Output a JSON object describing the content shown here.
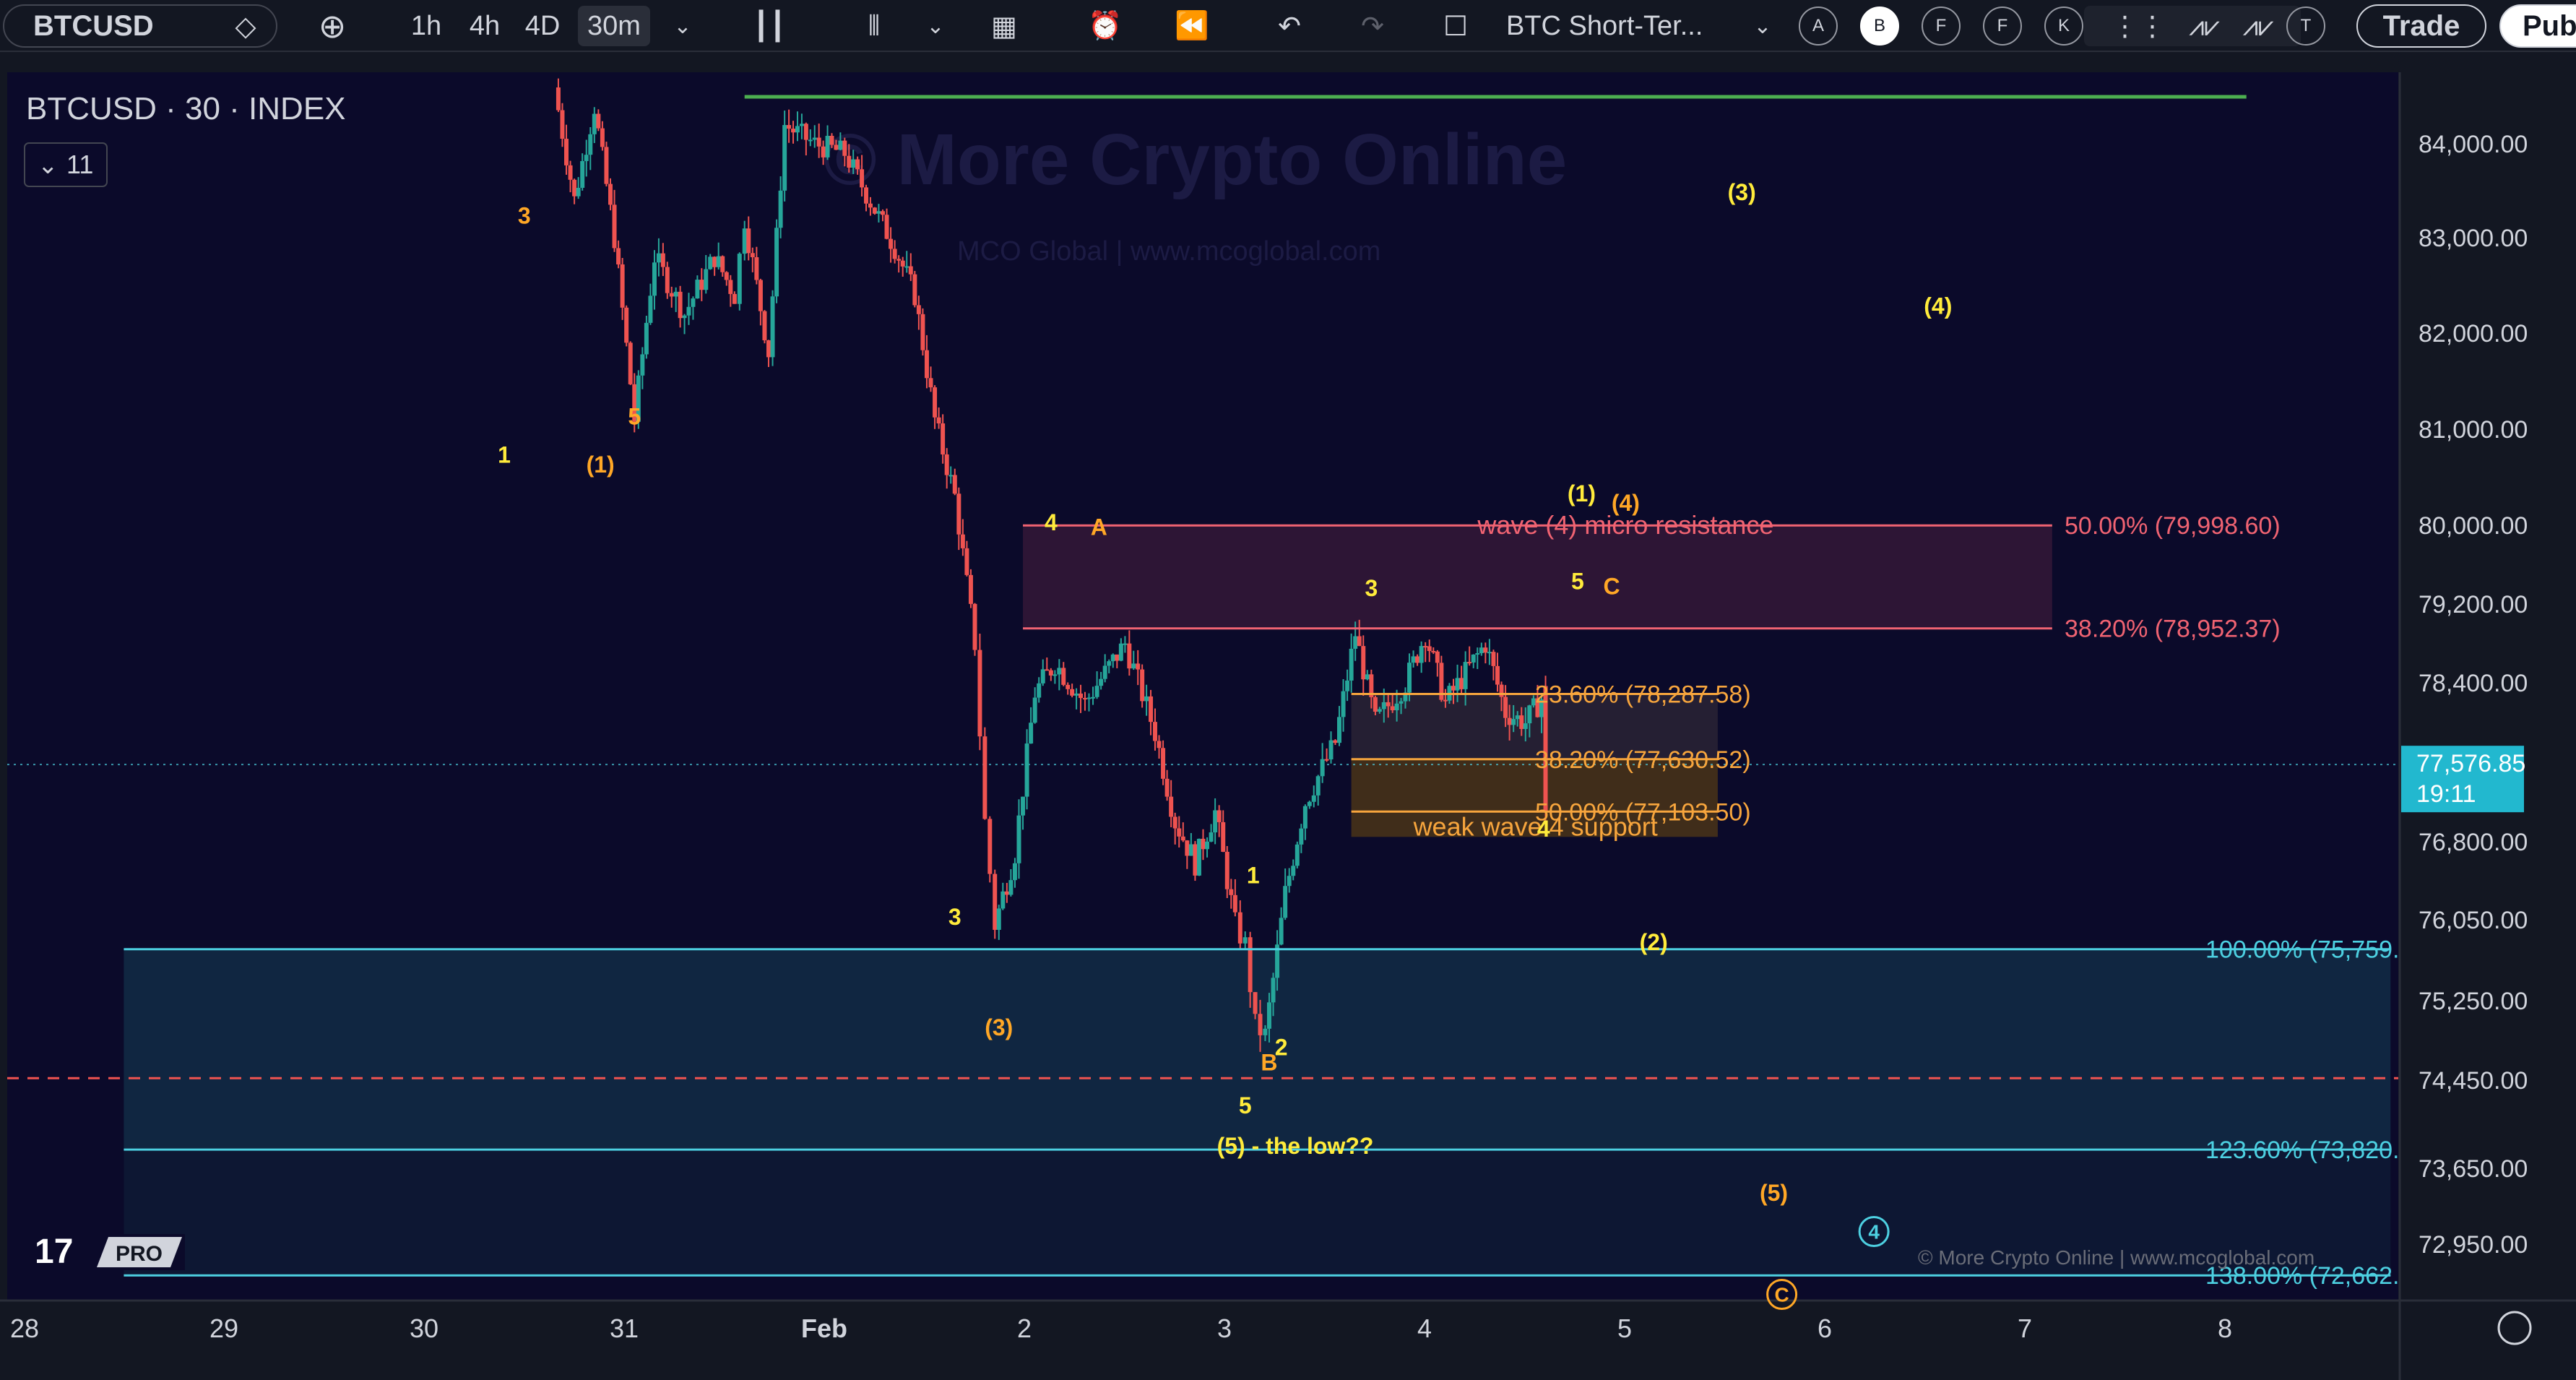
{
  "toolbar": {
    "symbol": "BTCUSD",
    "intervals": [
      "1h",
      "4h",
      "4D",
      "30m"
    ],
    "active_interval": "30m",
    "layout_name": "BTC Short-Ter...",
    "alert_buttons": [
      "A",
      "B",
      "F",
      "F",
      "K",
      "T"
    ],
    "trade_label": "Trade",
    "publish_label": "Pub",
    "icons": [
      "gem-icon",
      "plus-icon",
      "chevron-down-icon",
      "candles-icon",
      "indicators-icon",
      "chevron-down-icon",
      "templates-icon",
      "alert-icon",
      "replay-icon",
      "undo-icon",
      "redo-icon",
      "layout-square-icon",
      "chevron-down-icon"
    ]
  },
  "chart_header": {
    "title": "BTCUSD · 30 · INDEX",
    "indicators_count": "11"
  },
  "watermark": {
    "main": "© More Crypto Online",
    "sub": "MCO Global  |  www.mcoglobal.com",
    "footer": "© More Crypto Online  |  www.mcoglobal.com",
    "logo": "TV PRO"
  },
  "colors": {
    "background": "#0b0a2a",
    "up_candle": "#26a69a",
    "down_candle": "#ef5350",
    "resistance": "#f06372",
    "support": "#f7a53d",
    "cyan": "#4dd0e1",
    "green_line": "#4caf50",
    "wave_yellow": "#ffeb3b",
    "wave_orange": "#ffa726"
  },
  "chart_data": {
    "type": "candlestick",
    "title": "BTCUSD · 30 · INDEX",
    "y_ticks": [
      "84,000.00",
      "83,000.00",
      "82,000.00",
      "81,000.00",
      "80,000.00",
      "79,200.00",
      "78,400.00",
      "76,800.00",
      "76,050.00",
      "75,250.00",
      "74,450.00",
      "73,650.00",
      "72,950.00"
    ],
    "y_tick_values": [
      84000,
      83000,
      82000,
      81000,
      80000,
      79200,
      78400,
      76800,
      76050,
      75250,
      74450,
      73650,
      72950
    ],
    "x_ticks": [
      "28",
      "29",
      "30",
      "31",
      "Feb",
      "2",
      "3",
      "4",
      "5",
      "6",
      "7",
      "8"
    ],
    "x_tick_values": [
      28,
      29,
      30,
      31,
      32,
      33,
      34,
      35,
      36,
      37,
      38,
      39
    ],
    "last_price": "77,576.85",
    "last_price_value": 77576.85,
    "countdown": "19:11",
    "dashed_level": 74470,
    "price_path": [
      [
        29.65,
        84600
      ],
      [
        29.75,
        83400
      ],
      [
        29.85,
        84400
      ],
      [
        29.95,
        83000
      ],
      [
        30.05,
        81100
      ],
      [
        30.15,
        82800
      ],
      [
        30.3,
        82200
      ],
      [
        30.45,
        82800
      ],
      [
        30.55,
        82400
      ],
      [
        30.6,
        83200
      ],
      [
        30.72,
        81800
      ],
      [
        30.8,
        84200
      ],
      [
        30.95,
        84000
      ],
      [
        31.1,
        83900
      ],
      [
        31.25,
        83300
      ],
      [
        31.35,
        82900
      ],
      [
        31.45,
        82400
      ],
      [
        31.55,
        81100
      ],
      [
        31.65,
        80300
      ],
      [
        31.75,
        78800
      ],
      [
        31.8,
        77000
      ],
      [
        31.85,
        76000
      ],
      [
        31.95,
        76700
      ],
      [
        32.05,
        78300
      ],
      [
        32.15,
        78600
      ],
      [
        32.3,
        78200
      ],
      [
        32.5,
        78800
      ],
      [
        32.65,
        77900
      ],
      [
        32.75,
        77000
      ],
      [
        32.85,
        76600
      ],
      [
        32.95,
        77100
      ],
      [
        33.05,
        76000
      ],
      [
        33.1,
        75800
      ],
      [
        33.15,
        75000
      ],
      [
        33.2,
        74900
      ],
      [
        33.3,
        76300
      ],
      [
        33.4,
        77200
      ],
      [
        33.55,
        77800
      ],
      [
        33.65,
        78900
      ],
      [
        33.75,
        78000
      ],
      [
        33.9,
        78400
      ],
      [
        34.0,
        78900
      ],
      [
        34.1,
        78200
      ],
      [
        34.2,
        78500
      ],
      [
        34.3,
        78800
      ],
      [
        34.4,
        78100
      ],
      [
        34.5,
        78000
      ],
      [
        34.6,
        78300
      ],
      [
        34.6,
        77150
      ]
    ],
    "levels": [
      {
        "label": "50.00% (79,998.60)",
        "value": 79998.6,
        "color": "#f06372",
        "x_start": 31.99,
        "x_end": 37.13
      },
      {
        "label": "38.20% (78,952.37)",
        "value": 78952.37,
        "color": "#f06372",
        "x_start": 31.99,
        "x_end": 37.13
      },
      {
        "label": "23.60% (78,287.58)",
        "value": 78287.58,
        "color": "#f7a53d",
        "x_start": 33.63,
        "x_end": 35.46
      },
      {
        "label": "38.20% (77,630.52)",
        "value": 77630.52,
        "color": "#f7a53d",
        "x_start": 33.63,
        "x_end": 35.46
      },
      {
        "label": "50.00% (77,103.50)",
        "value": 77103.5,
        "color": "#f7a53d",
        "x_start": 33.63,
        "x_end": 35.46
      },
      {
        "label": "100.00% (75,759.",
        "value": 75759,
        "color": "#4dd0e1",
        "x_start": 27.5,
        "x_end": 38.82
      },
      {
        "label": "123.60% (73,820.",
        "value": 73820,
        "color": "#4dd0e1",
        "x_start": 27.5,
        "x_end": 38.82
      },
      {
        "label": "138.00% (72,662.",
        "value": 72662,
        "color": "#4dd0e1",
        "x_start": 27.5,
        "x_end": 38.82
      }
    ],
    "zone_labels": [
      {
        "text": "wave (4) micro resistance",
        "x": 35.0,
        "y": 79998.6,
        "color": "#f06372"
      },
      {
        "text": "weak wave 4 support",
        "x": 34.55,
        "y": 76950,
        "color": "#f7a53d"
      }
    ],
    "green_line": {
      "value": 84500,
      "x_start": 30.6,
      "x_end": 38.1
    },
    "wave_labels": [
      {
        "t": "3",
        "x": 29.5,
        "y": 83150,
        "c": "#ffa726"
      },
      {
        "t": "5",
        "x": 30.05,
        "y": 81050,
        "c": "#ffa726"
      },
      {
        "t": "1",
        "x": 29.4,
        "y": 80650,
        "c": "#ffeb3b"
      },
      {
        "t": "(1)",
        "x": 29.88,
        "y": 80550,
        "c": "#ffa726"
      },
      {
        "t": "4",
        "x": 32.13,
        "y": 79950,
        "c": "#ffeb3b"
      },
      {
        "t": "A",
        "x": 32.37,
        "y": 79900,
        "c": "#ffa726"
      },
      {
        "t": "3",
        "x": 33.73,
        "y": 79280,
        "c": "#ffeb3b"
      },
      {
        "t": "(1)",
        "x": 34.78,
        "y": 80250,
        "c": "#ffeb3b"
      },
      {
        "t": "(4)",
        "x": 35.0,
        "y": 80150,
        "c": "#ffa726"
      },
      {
        "t": "5",
        "x": 34.76,
        "y": 79350,
        "c": "#ffeb3b"
      },
      {
        "t": "C",
        "x": 34.93,
        "y": 79300,
        "c": "#ffa726"
      },
      {
        "t": "(3)",
        "x": 35.58,
        "y": 83400,
        "c": "#ffeb3b"
      },
      {
        "t": "(4)",
        "x": 36.56,
        "y": 82200,
        "c": "#ffeb3b"
      },
      {
        "t": "4",
        "x": 34.59,
        "y": 76850,
        "c": "#ffeb3b"
      },
      {
        "t": "3",
        "x": 31.65,
        "y": 76000,
        "c": "#ffeb3b"
      },
      {
        "t": "(3)",
        "x": 31.87,
        "y": 74900,
        "c": "#ffa726"
      },
      {
        "t": "1",
        "x": 33.14,
        "y": 76400,
        "c": "#ffeb3b"
      },
      {
        "t": "2",
        "x": 33.28,
        "y": 74700,
        "c": "#ffeb3b"
      },
      {
        "t": "B",
        "x": 33.22,
        "y": 74550,
        "c": "#ffa726"
      },
      {
        "t": "5",
        "x": 33.1,
        "y": 74150,
        "c": "#ffeb3b"
      },
      {
        "t": "(5) - the low??",
        "x": 33.35,
        "y": 73780,
        "c": "#ffeb3b"
      },
      {
        "t": "(2)",
        "x": 35.14,
        "y": 75750,
        "c": "#ffeb3b"
      },
      {
        "t": "(5)",
        "x": 35.74,
        "y": 73350,
        "c": "#ffa726"
      },
      {
        "t": "4",
        "x": 36.24,
        "y": 73000,
        "c": "#4dd0e1",
        "circled": true
      },
      {
        "t": "C",
        "x": 35.78,
        "y": 72420,
        "c": "#ffa726",
        "circled": true
      }
    ]
  }
}
